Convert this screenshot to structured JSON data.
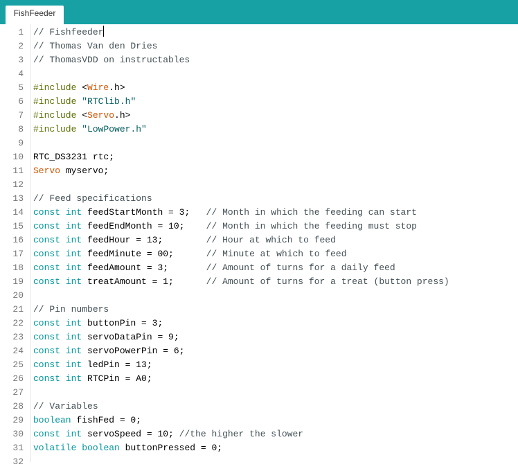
{
  "tab": {
    "label": "FishFeeder"
  },
  "colors": {
    "bar": "#17a1a5",
    "keyword": "#00979c",
    "preprocessor": "#5e6d03",
    "library": "#d35400",
    "string": "#005c5f",
    "comment": "#434f54"
  },
  "lines": [
    [
      [
        "comment",
        "// Fishfeeder"
      ]
    ],
    [
      [
        "comment",
        "// Thomas Van den Dries"
      ]
    ],
    [
      [
        "comment",
        "// ThomasVDD on instructables"
      ]
    ],
    [],
    [
      [
        "pp",
        "#include"
      ],
      [
        "plain",
        " <"
      ],
      [
        "lib",
        "Wire"
      ],
      [
        "plain",
        ".h>"
      ]
    ],
    [
      [
        "pp",
        "#include"
      ],
      [
        "plain",
        " "
      ],
      [
        "str",
        "\"RTClib.h\""
      ]
    ],
    [
      [
        "pp",
        "#include"
      ],
      [
        "plain",
        " <"
      ],
      [
        "lib",
        "Servo"
      ],
      [
        "plain",
        ".h>"
      ]
    ],
    [
      [
        "pp",
        "#include"
      ],
      [
        "plain",
        " "
      ],
      [
        "str",
        "\"LowPower.h\""
      ]
    ],
    [],
    [
      [
        "plain",
        "RTC_DS3231 rtc;"
      ]
    ],
    [
      [
        "lib",
        "Servo"
      ],
      [
        "plain",
        " myservo;"
      ]
    ],
    [],
    [
      [
        "comment",
        "// Feed specifications"
      ]
    ],
    [
      [
        "kw",
        "const"
      ],
      [
        "plain",
        " "
      ],
      [
        "kw",
        "int"
      ],
      [
        "plain",
        " feedStartMonth = 3;   "
      ],
      [
        "comment",
        "// Month in which the feeding can start"
      ]
    ],
    [
      [
        "kw",
        "const"
      ],
      [
        "plain",
        " "
      ],
      [
        "kw",
        "int"
      ],
      [
        "plain",
        " feedEndMonth = 10;    "
      ],
      [
        "comment",
        "// Month in which the feeding must stop"
      ]
    ],
    [
      [
        "kw",
        "const"
      ],
      [
        "plain",
        " "
      ],
      [
        "kw",
        "int"
      ],
      [
        "plain",
        " feedHour = 13;        "
      ],
      [
        "comment",
        "// Hour at which to feed"
      ]
    ],
    [
      [
        "kw",
        "const"
      ],
      [
        "plain",
        " "
      ],
      [
        "kw",
        "int"
      ],
      [
        "plain",
        " feedMinute = 00;      "
      ],
      [
        "comment",
        "// Minute at which to feed"
      ]
    ],
    [
      [
        "kw",
        "const"
      ],
      [
        "plain",
        " "
      ],
      [
        "kw",
        "int"
      ],
      [
        "plain",
        " feedAmount = 3;       "
      ],
      [
        "comment",
        "// Amount of turns for a daily feed"
      ]
    ],
    [
      [
        "kw",
        "const"
      ],
      [
        "plain",
        " "
      ],
      [
        "kw",
        "int"
      ],
      [
        "plain",
        " treatAmount = 1;      "
      ],
      [
        "comment",
        "// Amount of turns for a treat (button press)"
      ]
    ],
    [],
    [
      [
        "comment",
        "// Pin numbers"
      ]
    ],
    [
      [
        "kw",
        "const"
      ],
      [
        "plain",
        " "
      ],
      [
        "kw",
        "int"
      ],
      [
        "plain",
        " buttonPin = 3;"
      ]
    ],
    [
      [
        "kw",
        "const"
      ],
      [
        "plain",
        " "
      ],
      [
        "kw",
        "int"
      ],
      [
        "plain",
        " servoDataPin = 9;"
      ]
    ],
    [
      [
        "kw",
        "const"
      ],
      [
        "plain",
        " "
      ],
      [
        "kw",
        "int"
      ],
      [
        "plain",
        " servoPowerPin = 6;"
      ]
    ],
    [
      [
        "kw",
        "const"
      ],
      [
        "plain",
        " "
      ],
      [
        "kw",
        "int"
      ],
      [
        "plain",
        " ledPin = 13;"
      ]
    ],
    [
      [
        "kw",
        "const"
      ],
      [
        "plain",
        " "
      ],
      [
        "kw",
        "int"
      ],
      [
        "plain",
        " RTCPin = A0;"
      ]
    ],
    [],
    [
      [
        "comment",
        "// Variables"
      ]
    ],
    [
      [
        "kw",
        "boolean"
      ],
      [
        "plain",
        " fishFed = 0;"
      ]
    ],
    [
      [
        "kw",
        "const"
      ],
      [
        "plain",
        " "
      ],
      [
        "kw",
        "int"
      ],
      [
        "plain",
        " servoSpeed = 10; "
      ],
      [
        "comment",
        "//the higher the slower"
      ]
    ],
    [
      [
        "kw",
        "volatile"
      ],
      [
        "plain",
        " "
      ],
      [
        "kw",
        "boolean"
      ],
      [
        "plain",
        " buttonPressed = 0;"
      ]
    ],
    []
  ]
}
